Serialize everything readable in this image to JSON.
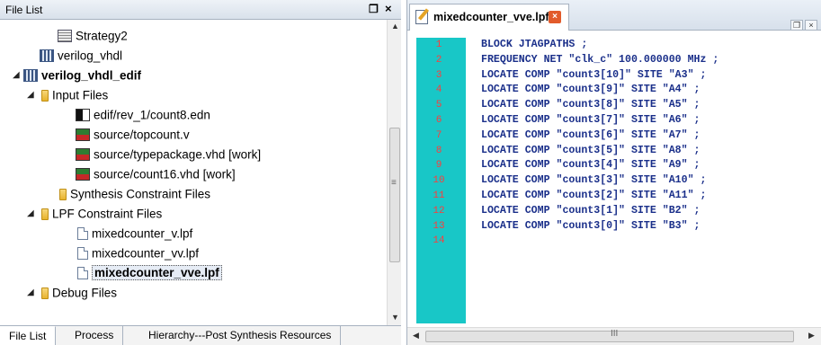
{
  "file_list": {
    "title": "File List",
    "pin_glyph": "ő",
    "close_glyph": "×",
    "tree": [
      {
        "label": "Strategy2",
        "icon": "strategy-icon",
        "bold": false,
        "selected": false,
        "expander": ""
      },
      {
        "label": "verilog_vhdl",
        "icon": "implementation-icon",
        "bold": false,
        "selected": false,
        "expander": ""
      },
      {
        "label": "verilog_vhdl_edif",
        "icon": "implementation-icon",
        "bold": true,
        "selected": false,
        "expander": "◢"
      },
      {
        "label": "Input Files",
        "icon": "folder-icon",
        "bold": false,
        "selected": false,
        "expander": "◢"
      },
      {
        "label": "edif/rev_1/count8.edn",
        "icon": "edif-file-icon",
        "bold": false,
        "selected": false,
        "expander": ""
      },
      {
        "label": "source/topcount.v",
        "icon": "verilog-file-icon",
        "bold": false,
        "selected": false,
        "expander": ""
      },
      {
        "label": "source/typepackage.vhd [work]",
        "icon": "vhdl-file-icon",
        "bold": false,
        "selected": false,
        "expander": ""
      },
      {
        "label": "source/count16.vhd [work]",
        "icon": "vhdl-file-icon",
        "bold": false,
        "selected": false,
        "expander": ""
      },
      {
        "label": "Synthesis Constraint Files",
        "icon": "folder-icon",
        "bold": false,
        "selected": false,
        "expander": ""
      },
      {
        "label": "LPF Constraint Files",
        "icon": "folder-icon",
        "bold": false,
        "selected": false,
        "expander": "◢"
      },
      {
        "label": "mixedcounter_v.lpf",
        "icon": "lpf-file-icon",
        "bold": false,
        "selected": false,
        "expander": ""
      },
      {
        "label": "mixedcounter_vv.lpf",
        "icon": "lpf-file-icon",
        "bold": false,
        "selected": false,
        "expander": ""
      },
      {
        "label": "mixedcounter_vve.lpf",
        "icon": "lpf-file-icon",
        "bold": true,
        "selected": true,
        "expander": ""
      },
      {
        "label": "Debug Files",
        "icon": "folder-icon",
        "bold": false,
        "selected": false,
        "expander": "◢"
      }
    ],
    "bottom_tabs": [
      "File List",
      "Process",
      "Hierarchy---Post Synthesis Resources"
    ]
  },
  "editor": {
    "tab_title": "mixedcounter_vve.lpf",
    "tab_close_glyph": "×",
    "lines": [
      "BLOCK JTAGPATHS ;",
      "FREQUENCY NET \"clk_c\" 100.000000 MHz ;",
      "LOCATE COMP \"count3[10]\" SITE \"A3\" ;",
      "LOCATE COMP \"count3[9]\" SITE \"A4\" ;",
      "LOCATE COMP \"count3[8]\" SITE \"A5\" ;",
      "LOCATE COMP \"count3[7]\" SITE \"A6\" ;",
      "LOCATE COMP \"count3[6]\" SITE \"A7\" ;",
      "LOCATE COMP \"count3[5]\" SITE \"A8\" ;",
      "LOCATE COMP \"count3[4]\" SITE \"A9\" ;",
      "LOCATE COMP \"count3[3]\" SITE \"A10\" ;",
      "LOCATE COMP \"count3[2]\" SITE \"A11\" ;",
      "LOCATE COMP \"count3[1]\" SITE \"B2\" ;",
      "LOCATE COMP \"count3[0]\" SITE \"B3\" ;",
      ""
    ],
    "line_numbers": [
      "1",
      "2",
      "3",
      "4",
      "5",
      "6",
      "7",
      "8",
      "9",
      "10",
      "11",
      "12",
      "13",
      "14"
    ],
    "gutter_color": "#18c7c7",
    "line_number_color": "#ff3b3b",
    "code_color": "#1a2f8a",
    "hscroll_grip": "III"
  }
}
